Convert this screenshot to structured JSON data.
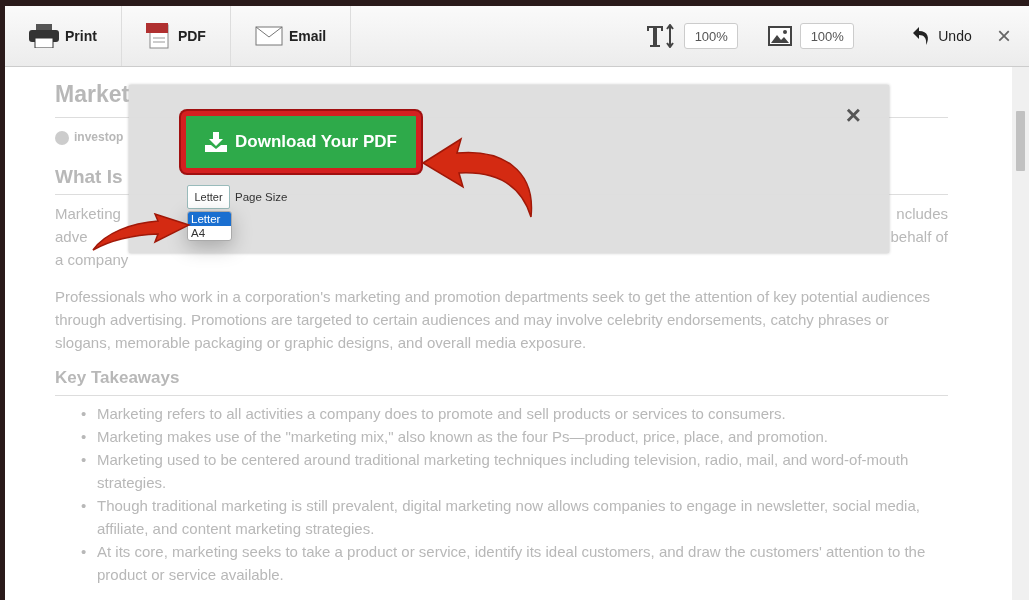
{
  "toolbar": {
    "buttons": [
      {
        "kind": "print",
        "label": "Print"
      },
      {
        "kind": "pdf",
        "label": "PDF"
      },
      {
        "kind": "email",
        "label": "Email"
      }
    ],
    "text_size": {
      "value": "100%"
    },
    "image_size": {
      "value": "100%"
    },
    "undo": {
      "label": "Undo"
    },
    "close": "×"
  },
  "article": {
    "title_visible": "Market",
    "source_visible": "investop",
    "heading_visible": "What Is",
    "intro_lines": [
      {
        "left": "Marketing",
        "right": "ncludes"
      },
      {
        "left": "adve",
        "right": "behalf of"
      },
      {
        "left": "a company"
      }
    ],
    "bullet": "•",
    "paragraph": "Professionals who work in a corporation's marketing and promotion departments seek to get the attention of key potential audiences through advertising. Promotions are targeted to certain audiences and may involve celebrity endorsements, catchy phrases or slogans, memorable packaging or graphic designs, and overall media exposure.",
    "takeaways_heading": "Key Takeaways",
    "takeaways": [
      "Marketing refers to all activities a company does to promote and sell products or services to consumers.",
      "Marketing makes use of the \"marketing mix,\" also known as the four Ps—product, price, place, and promotion.",
      "Marketing used to be centered around traditional marketing techniques including television, radio, mail, and word-of-mouth strategies.",
      "Though traditional marketing is still prevalent, digital marketing now allows companies to engage in newsletter, social media, affiliate, and content marketing strategies.",
      "At its core, marketing seeks to take a product or service, identify its ideal customers, and draw the customers' attention to the product or service available."
    ]
  },
  "dialog": {
    "close": "×",
    "download_button": "Download Your PDF",
    "page_size": {
      "value": "Letter",
      "label": "Page Size",
      "expanded": true,
      "options": [
        {
          "label": "Letter",
          "selected": true
        },
        {
          "label": "A4",
          "selected": false
        }
      ]
    }
  }
}
